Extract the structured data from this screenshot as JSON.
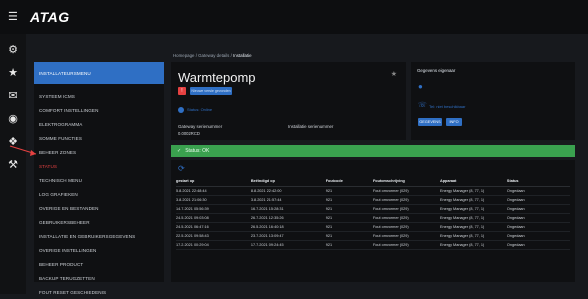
{
  "app": {
    "logo": "ATAG"
  },
  "rail_icons": [
    "gear-icon",
    "star-icon",
    "mail-icon",
    "pin-icon",
    "help-icon",
    "wrench-icon"
  ],
  "left_menu": [
    "INSTALLATEURSMENU",
    "SYSTEEM ICMS",
    "COMFORT INSTELLINGEN",
    "ELEKTROGRAMMA",
    "SOMME FUNCTIES",
    "BEHEER ZONES",
    "STATUS",
    "TECHNISCH MENU",
    "LOG GRAFIEKEN",
    "OVERIGE EN BESTANDEN",
    "GEBRUIKERSBEHEER",
    "INSTALLATIE EN GEBRUIKERSGEGEVENS",
    "OVERIGE INSTELLINGEN",
    "BEHEER PRODUCT",
    "BACKUP TERUGZETTEN",
    "FOUT RESET GESCHIEDENIS"
  ],
  "breadcrumb": {
    "trail": "Homepage / Gateway details / ",
    "current": "Installatie"
  },
  "main": {
    "title": "Warmtepomp",
    "warning_icon": "!",
    "update_button": "Nieuwe versie gevonden",
    "status_link": "Status: Online",
    "gateway_label": "Gateway serienummer",
    "gateway_value": "0.0002RCD",
    "installation_label": "Installatie serienummer"
  },
  "side": {
    "title": "Gegevens eigenaar",
    "phone_text": "Tel: niet beschikbaar",
    "button1": "GEGEVENS",
    "button2": "INFO"
  },
  "status_bar": {
    "text": "Status: OK"
  },
  "log": {
    "columns": [
      "gestart op",
      "Beëindigd op",
      "Foutcode",
      "Foutomschrijving",
      "Apparaat",
      "Status"
    ],
    "rows": [
      [
        "5.8.2021 22:48:44",
        "8.8.2021 22:42:00",
        "921",
        "Fout omvormer (029)",
        "Energy Manager (8, 77, 1)",
        "Ongedaan"
      ],
      [
        "3.8.2021 21:06:30",
        "3.8.2021 21:57:44",
        "921",
        "Fout omvormer (029)",
        "Energy Manager (8, 77, 1)",
        "Ongedaan"
      ],
      [
        "14.7.2021 05:56:39",
        "16.7.2021 15:28:31",
        "921",
        "Fout omvormer (029)",
        "Energy Manager (8, 77, 1)",
        "Ongedaan"
      ],
      [
        "24.5.2021 09:03:08",
        "26.7.2021 12:35:26",
        "921",
        "Fout omvormer (029)",
        "Energy Manager (8, 77, 1)",
        "Ongedaan"
      ],
      [
        "24.5.2021 06:47:16",
        "26.5.2021 16:40:18",
        "921",
        "Fout omvormer (029)",
        "Energy Manager (8, 77, 1)",
        "Ongedaan"
      ],
      [
        "22.5.2021 09:58:43",
        "23.7.2021 13:09:47",
        "921",
        "Fout omvormer (029)",
        "Energy Manager (8, 77, 1)",
        "Ongedaan"
      ],
      [
        "17.2.2021 00:29:04",
        "17.7.2021 09:24:45",
        "921",
        "Fout omvormer (029)",
        "Energy Manager (8, 77, 1)",
        "Ongedaan"
      ]
    ]
  },
  "colors": {
    "accent": "#2f6fc4",
    "ok_green": "#3aa14f",
    "alert_red": "#e64141"
  }
}
